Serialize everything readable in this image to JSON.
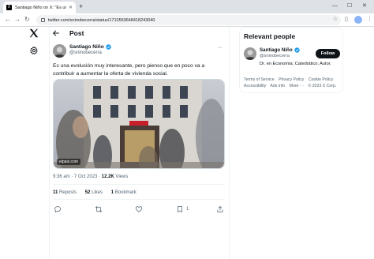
{
  "browser": {
    "tab_title": "Santiago Niño on X: \"Es una ev",
    "tab_favicon": "X",
    "url": "twitter.com/sninobecerra/status/1710559648418243040",
    "icons": [
      "back-icon",
      "forward-icon",
      "reload-icon",
      "star-icon",
      "sidepanel-icon",
      "profile-icon",
      "menu-icon"
    ]
  },
  "nav": {
    "logo": "x-logo-icon",
    "settings": "gear-icon"
  },
  "header": {
    "title": "Post"
  },
  "tweet": {
    "author_name": "Santiago Niño",
    "author_handle": "@sninobecerra",
    "text": "Es una evolución muy interesante, pero pienso que en poco va a contribuir a aumentar la oferta de vivienda social.",
    "media_source": "elpais.com",
    "time": "9:36 am",
    "date": "7 Oct 2023",
    "views_count": "12.2K",
    "views_label": "Views",
    "reposts_count": "11",
    "reposts_label": "Reposts",
    "likes_count": "52",
    "likes_label": "Likes",
    "bookmarks_count": "1",
    "bookmarks_label": "Bookmark",
    "actions": {
      "reply": "",
      "repost": "",
      "like": "",
      "bookmark": "1",
      "share": ""
    }
  },
  "sidebar": {
    "relevant_title": "Relevant people",
    "person_name": "Santiago Niño",
    "person_handle": "@sninobecerra",
    "person_bio": "Dr. en Economía; Catedrático; Autor.",
    "follow_label": "Follow",
    "footer_links": [
      "Terms of Service",
      "Privacy Policy",
      "Cookie Policy",
      "Accessibility",
      "Ads info",
      "More ···",
      "© 2023 X Corp."
    ]
  },
  "colors": {
    "text": "#0f1419",
    "muted": "#536471",
    "verified": "#1d9bf0",
    "border": "#eff3f4"
  }
}
